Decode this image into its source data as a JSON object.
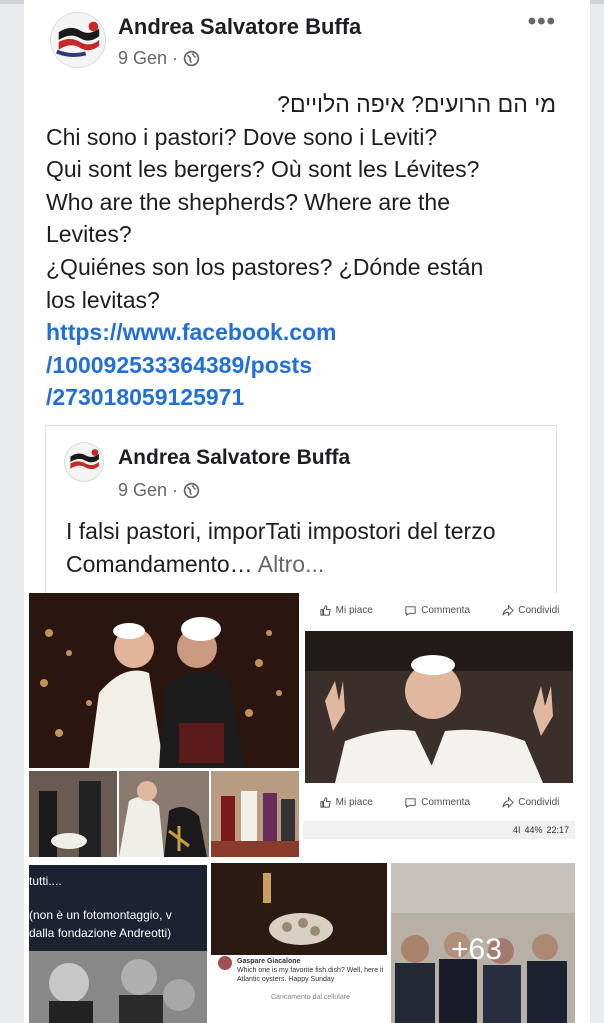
{
  "post": {
    "author": "Andrea Salvatore Buffa",
    "date": "9 Gen",
    "privacy_icon": "globe-icon",
    "menu_label": "•••",
    "lines": {
      "hebrew": "מי הם הרועים?  איפה הלויים?",
      "italian": "Chi sono i pastori? Dove sono i Leviti?",
      "french": "Qui sont les bergers?  Où sont les Lévites?",
      "english_1": "Who are the shepherds?  Where are the",
      "english_2": "Levites?",
      "spanish_1": "¿Quiénes son los pastores?  ¿Dónde están",
      "spanish_2": "los levitas?"
    },
    "link_lines": [
      "https://www.facebook.com",
      "/100092533364389/posts",
      "/273018059125971"
    ]
  },
  "shared_post": {
    "author": "Andrea Salvatore Buffa",
    "date": "9 Gen",
    "text": "I falsi pastori, imporTati impostori del terzo Comandamento…",
    "more": "Altro..."
  },
  "collage": {
    "actions": {
      "like": "Mi piace",
      "comment": "Commenta",
      "share": "Condividi"
    },
    "status_bar": {
      "signal": "4I",
      "battery": "44%",
      "time": "22:17"
    },
    "tutti_text": "tutti....",
    "caption_1": "(non è un fotomontaggio, v",
    "caption_2": "dalla fondazione Andreotti)",
    "more_count": "+63",
    "mini_comment": {
      "name": "Gaspare Giacalone",
      "text_1": "Which one is my favorite fish dish? Well, here it is: wild",
      "text_2": "Atlantic oysters. Happy Sunday",
      "footer": "Caricamento dal cellulare"
    }
  },
  "colors": {
    "link": "#216fdb",
    "text": "#1c1e21",
    "meta": "#65676b"
  }
}
